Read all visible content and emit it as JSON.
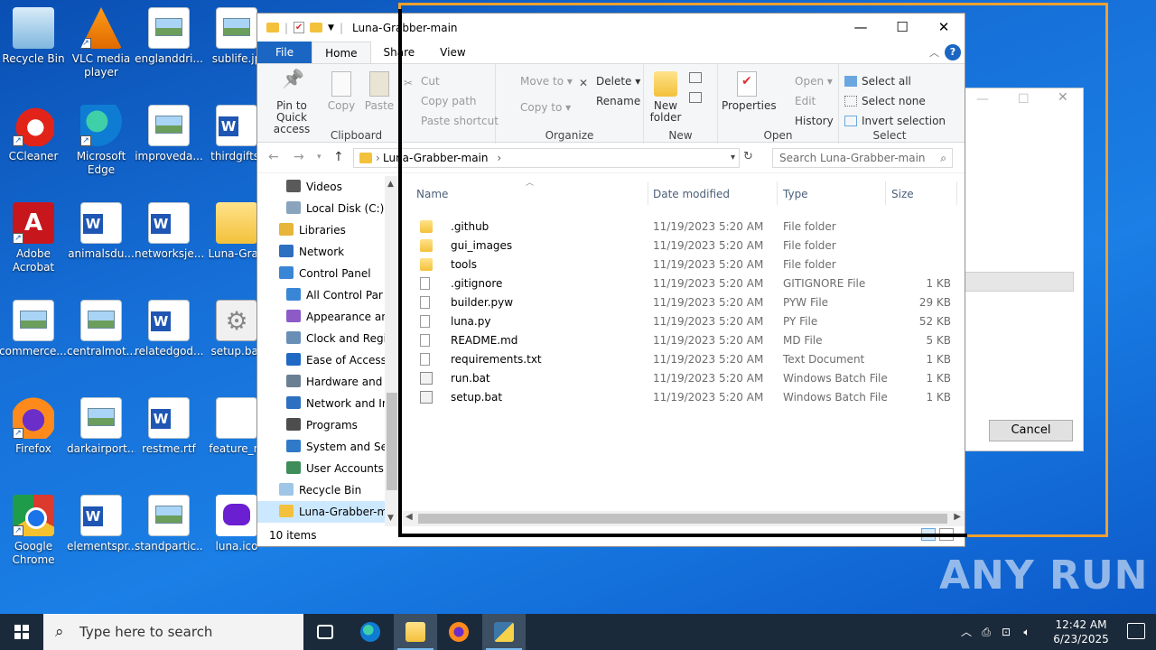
{
  "desktop": {
    "icons": [
      {
        "label": "Recycle Bin",
        "icon": "recycle-bin-icon"
      },
      {
        "label": "VLC media player",
        "icon": "vlc-icon"
      },
      {
        "label": "englanddri...",
        "icon": "image-file-icon"
      },
      {
        "label": "sublife.jp",
        "icon": "image-file-icon"
      },
      {
        "label": "CCleaner",
        "icon": "ccleaner-icon"
      },
      {
        "label": "Microsoft Edge",
        "icon": "edge-icon"
      },
      {
        "label": "improveda...",
        "icon": "image-file-icon"
      },
      {
        "label": "thirdgifts.",
        "icon": "word-file-icon"
      },
      {
        "label": "Adobe Acrobat",
        "icon": "acrobat-icon"
      },
      {
        "label": "animalsdu...",
        "icon": "word-file-icon"
      },
      {
        "label": "networksje...",
        "icon": "word-file-icon"
      },
      {
        "label": "Luna-Grab",
        "icon": "folder-icon"
      },
      {
        "label": "commerce....",
        "icon": "image-file-icon"
      },
      {
        "label": "centralmot...",
        "icon": "image-file-icon"
      },
      {
        "label": "relatedgod...",
        "icon": "word-file-icon"
      },
      {
        "label": "setup.bat",
        "icon": "batch-file-icon"
      },
      {
        "label": "Firefox",
        "icon": "firefox-icon"
      },
      {
        "label": "darkairport...",
        "icon": "image-file-icon"
      },
      {
        "label": "restme.rtf",
        "icon": "word-file-icon"
      },
      {
        "label": "feature_re",
        "icon": "blank-file-icon"
      },
      {
        "label": "Google Chrome",
        "icon": "chrome-icon"
      },
      {
        "label": "elementspr...",
        "icon": "word-file-icon"
      },
      {
        "label": "standpartic...",
        "icon": "image-file-icon"
      },
      {
        "label": "luna.ico",
        "icon": "luna-icon"
      }
    ]
  },
  "background_dialog": {
    "cancel_label": "Cancel"
  },
  "explorer": {
    "title": "Luna-Grabber-main",
    "tabs": {
      "file": "File",
      "home": "Home",
      "share": "Share",
      "view": "View"
    },
    "ribbon": {
      "clipboard": {
        "group": "Clipboard",
        "pin": "Pin to Quick access",
        "copy": "Copy",
        "paste": "Paste",
        "cut": "Cut",
        "copy_path": "Copy path",
        "paste_shortcut": "Paste shortcut"
      },
      "organize": {
        "group": "Organize",
        "move_to": "Move to",
        "copy_to": "Copy to",
        "delete": "Delete",
        "rename": "Rename"
      },
      "new": {
        "group": "New",
        "new_folder": "New folder"
      },
      "open": {
        "group": "Open",
        "properties": "Properties",
        "open": "Open",
        "edit": "Edit",
        "history": "History"
      },
      "select": {
        "group": "Select",
        "select_all": "Select all",
        "select_none": "Select none",
        "invert_selection": "Invert selection"
      }
    },
    "address": {
      "path": "Luna-Grabber-main",
      "search_placeholder": "Search Luna-Grabber-main"
    },
    "nav_items": [
      {
        "label": "Videos",
        "icon": "videos-icon"
      },
      {
        "label": "Local Disk (C:)",
        "icon": "drive-icon"
      },
      {
        "label": "Libraries",
        "icon": "libraries-icon"
      },
      {
        "label": "Network",
        "icon": "network-icon"
      },
      {
        "label": "Control Panel",
        "icon": "control-panel-icon"
      },
      {
        "label": "All Control Par",
        "icon": "control-panel-icon"
      },
      {
        "label": "Appearance an",
        "icon": "appearance-icon"
      },
      {
        "label": "Clock and Regi",
        "icon": "clock-icon"
      },
      {
        "label": "Ease of Access",
        "icon": "ease-access-icon"
      },
      {
        "label": "Hardware and",
        "icon": "hardware-icon"
      },
      {
        "label": "Network and Ir",
        "icon": "network-icon"
      },
      {
        "label": "Programs",
        "icon": "programs-icon"
      },
      {
        "label": "System and Se",
        "icon": "system-icon"
      },
      {
        "label": "User Accounts",
        "icon": "users-icon"
      },
      {
        "label": "Recycle Bin",
        "icon": "recycle-bin-icon"
      },
      {
        "label": "Luna-Grabber-m",
        "icon": "folder-icon"
      }
    ],
    "columns": {
      "name": "Name",
      "date": "Date modified",
      "type": "Type",
      "size": "Size"
    },
    "files": [
      {
        "name": ".github",
        "date": "11/19/2023 5:20 AM",
        "type": "File folder",
        "size": "",
        "kind": "folder"
      },
      {
        "name": "gui_images",
        "date": "11/19/2023 5:20 AM",
        "type": "File folder",
        "size": "",
        "kind": "folder"
      },
      {
        "name": "tools",
        "date": "11/19/2023 5:20 AM",
        "type": "File folder",
        "size": "",
        "kind": "folder"
      },
      {
        "name": ".gitignore",
        "date": "11/19/2023 5:20 AM",
        "type": "GITIGNORE File",
        "size": "1 KB",
        "kind": "file"
      },
      {
        "name": "builder.pyw",
        "date": "11/19/2023 5:20 AM",
        "type": "PYW File",
        "size": "29 KB",
        "kind": "file"
      },
      {
        "name": "luna.py",
        "date": "11/19/2023 5:20 AM",
        "type": "PY File",
        "size": "52 KB",
        "kind": "file"
      },
      {
        "name": "README.md",
        "date": "11/19/2023 5:20 AM",
        "type": "MD File",
        "size": "5 KB",
        "kind": "file"
      },
      {
        "name": "requirements.txt",
        "date": "11/19/2023 5:20 AM",
        "type": "Text Document",
        "size": "1 KB",
        "kind": "file"
      },
      {
        "name": "run.bat",
        "date": "11/19/2023 5:20 AM",
        "type": "Windows Batch File",
        "size": "1 KB",
        "kind": "bat"
      },
      {
        "name": "setup.bat",
        "date": "11/19/2023 5:20 AM",
        "type": "Windows Batch File",
        "size": "1 KB",
        "kind": "bat"
      }
    ],
    "status": "10 items"
  },
  "watermark": "ANY RUN",
  "taskbar": {
    "search_placeholder": "Type here to search",
    "time": "12:42 AM",
    "date": "6/23/2025"
  },
  "colors": {
    "accent": "#1a66c2",
    "selection": "#cce8ff",
    "taskbar": "#1b2a3a",
    "frame": "#f0a030"
  }
}
